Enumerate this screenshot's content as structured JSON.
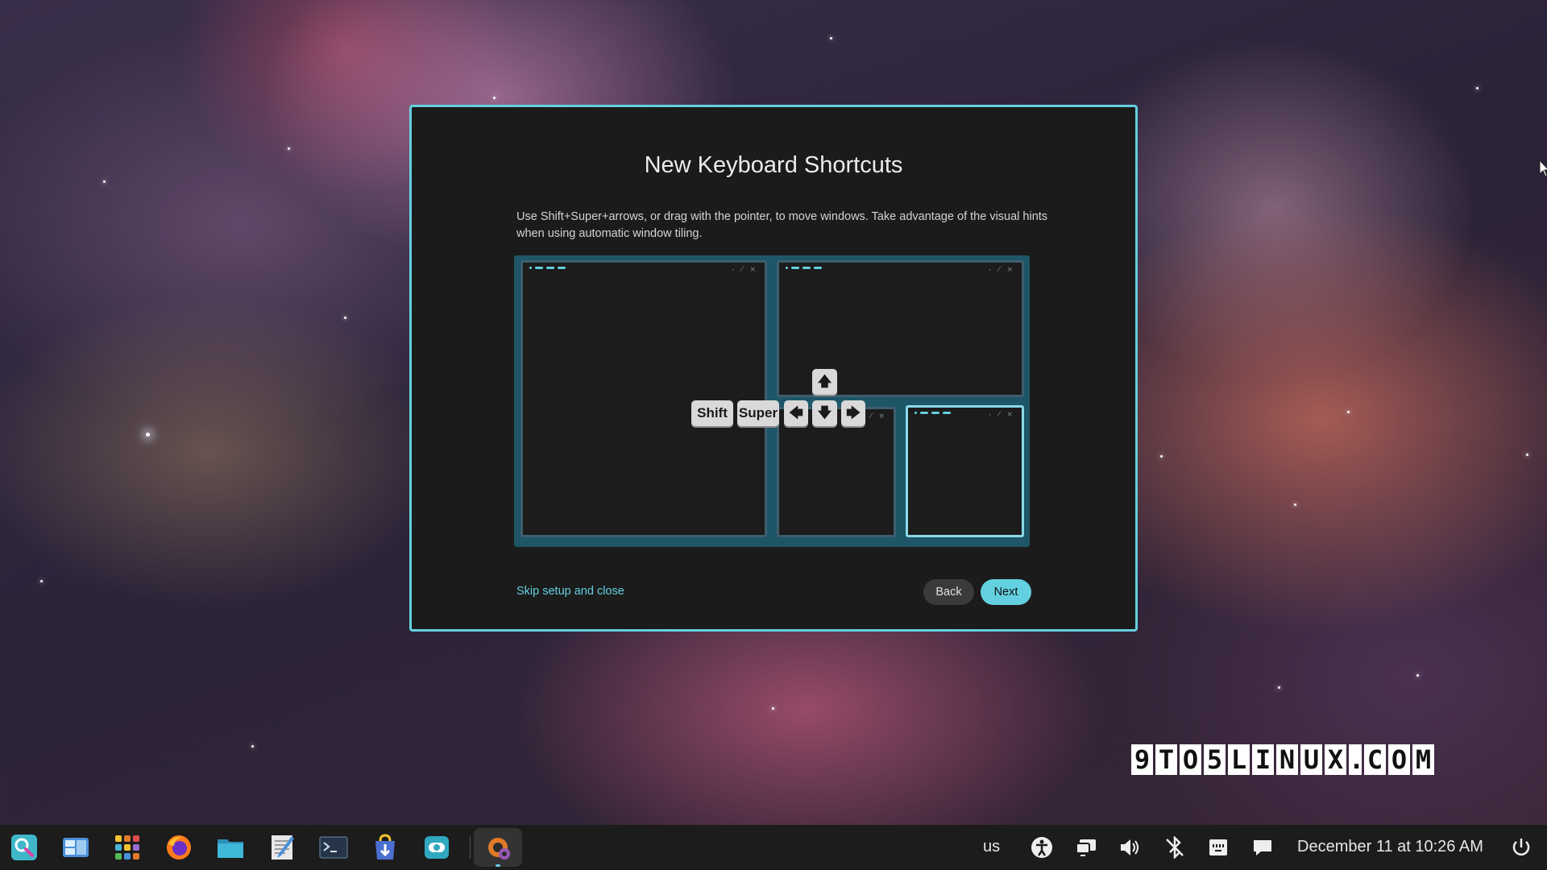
{
  "dialog": {
    "title": "New Keyboard Shortcuts",
    "description": "Use Shift+Super+arrows, or drag with the pointer, to move windows. Take advantage of the visual hints when using automatic window tiling.",
    "keys": {
      "shift": "Shift",
      "super": "Super",
      "up": "🡅",
      "left": "🡄",
      "down": "🡇",
      "right": "🡆"
    },
    "skip_label": "Skip setup and close",
    "back_label": "Back",
    "next_label": "Next"
  },
  "watermark": [
    "9",
    "T",
    "O",
    "5",
    "L",
    "I",
    "N",
    "U",
    "X",
    ".",
    "C",
    "O",
    "M"
  ],
  "taskbar": {
    "apps": [
      "launcher-icon",
      "workspaces-icon",
      "app-library-icon",
      "firefox-icon",
      "files-icon",
      "text-editor-icon",
      "terminal-icon",
      "app-store-icon",
      "settings-store-icon",
      "initial-setup-icon"
    ],
    "keyboard_layout": "us",
    "datetime": "December 11 at 10:26 AM"
  },
  "colors": {
    "accent": "#63d0df",
    "dialog_bg": "#1b1b1b",
    "taskbar_bg": "#1c1c1c"
  }
}
